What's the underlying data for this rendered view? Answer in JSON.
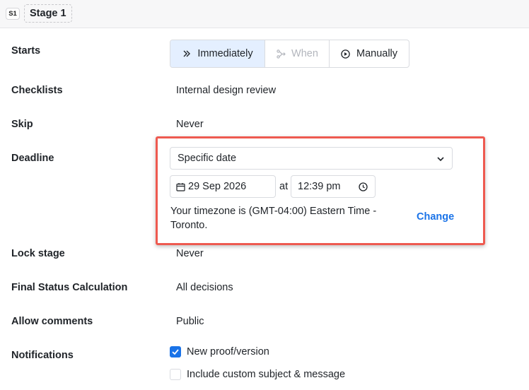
{
  "header": {
    "badge": "S1",
    "title": "Stage 1"
  },
  "starts": {
    "label": "Starts",
    "options": [
      {
        "label": "Immediately",
        "icon": "double-chevron-right-icon",
        "state": "active"
      },
      {
        "label": "When",
        "icon": "branch-icon",
        "state": "disabled"
      },
      {
        "label": "Manually",
        "icon": "play-circle-icon",
        "state": "default"
      }
    ]
  },
  "checklists": {
    "label": "Checklists",
    "value": "Internal design review"
  },
  "skip": {
    "label": "Skip",
    "value": "Never"
  },
  "deadline": {
    "label": "Deadline",
    "type_value": "Specific date",
    "date": "29 Sep 2026",
    "at": "at",
    "time": "12:39 pm",
    "timezone_text": "Your timezone is (GMT-04:00) Eastern Time - Toronto.",
    "change_label": "Change",
    "highlight_color": "#ee5a50"
  },
  "lock_stage": {
    "label": "Lock stage",
    "value": "Never"
  },
  "final_status": {
    "label": "Final Status Calculation",
    "value": "All decisions"
  },
  "allow_comments": {
    "label": "Allow comments",
    "value": "Public"
  },
  "notifications": {
    "label": "Notifications",
    "options": [
      {
        "label": "New proof/version",
        "checked": true
      },
      {
        "label": "Include custom subject & message",
        "checked": false
      }
    ]
  },
  "colors": {
    "accent": "#1a73e8",
    "active_bg": "#e4efff"
  }
}
